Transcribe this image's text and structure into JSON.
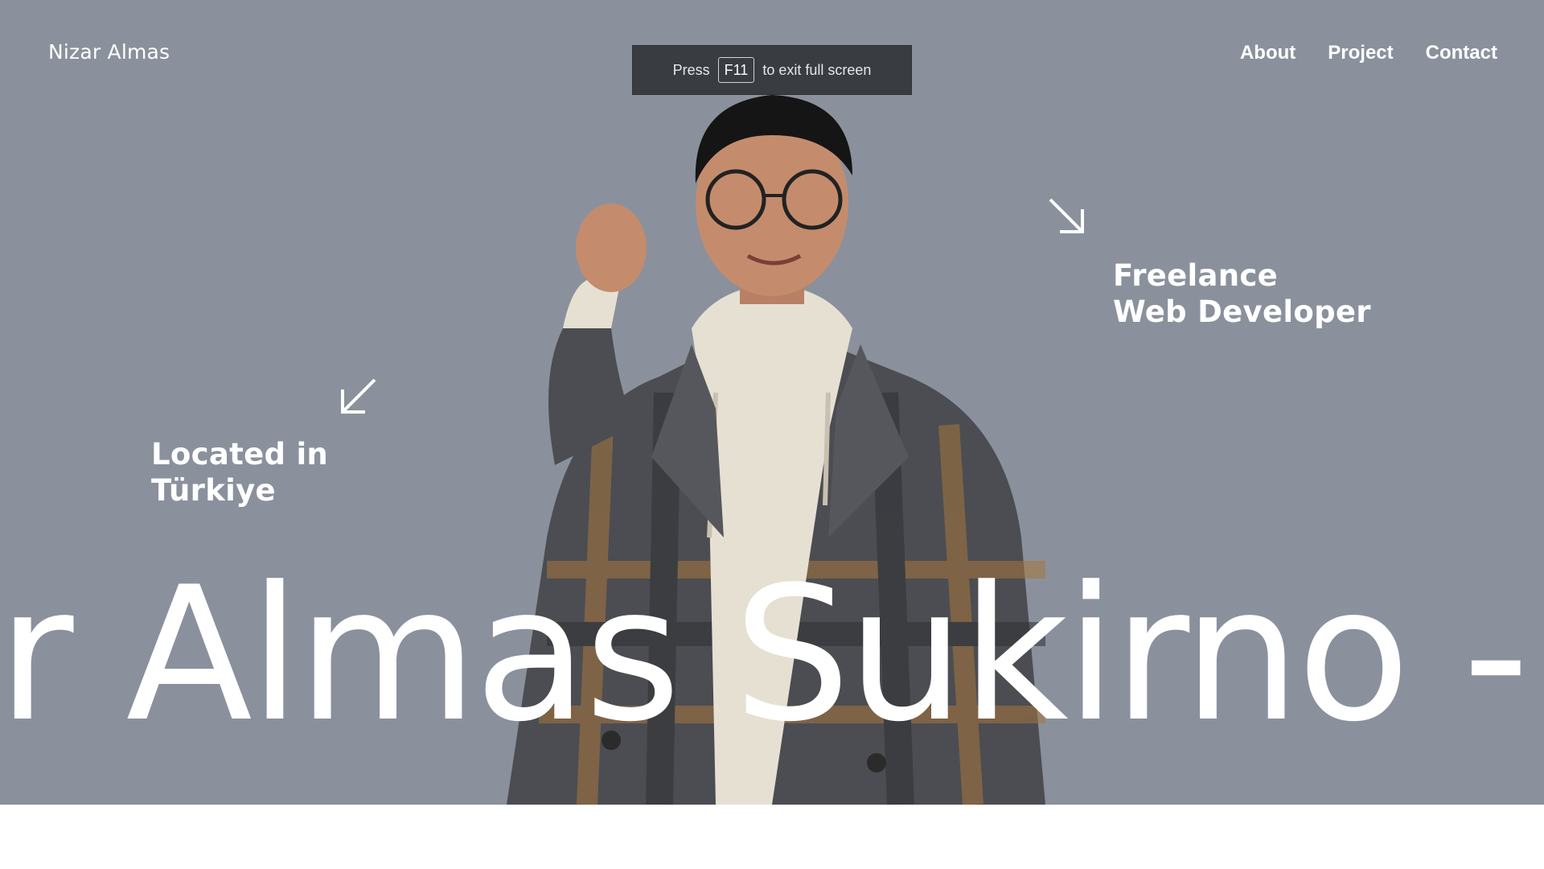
{
  "site": {
    "brand": "Nizar Almas"
  },
  "nav": {
    "items": [
      "About",
      "Project",
      "Contact"
    ]
  },
  "fullscreen_notice": {
    "prefix": "Press",
    "key": "F11",
    "suffix": "to exit full screen"
  },
  "hero": {
    "tagline": "Freelance\nWeb Developer",
    "location": "Located in\nTürkiye",
    "marquee_text": "ar Almas Sukirno -"
  },
  "colors": {
    "hero_bg": "#8a919c",
    "text": "#ffffff",
    "toast_bg": "#393c41"
  }
}
